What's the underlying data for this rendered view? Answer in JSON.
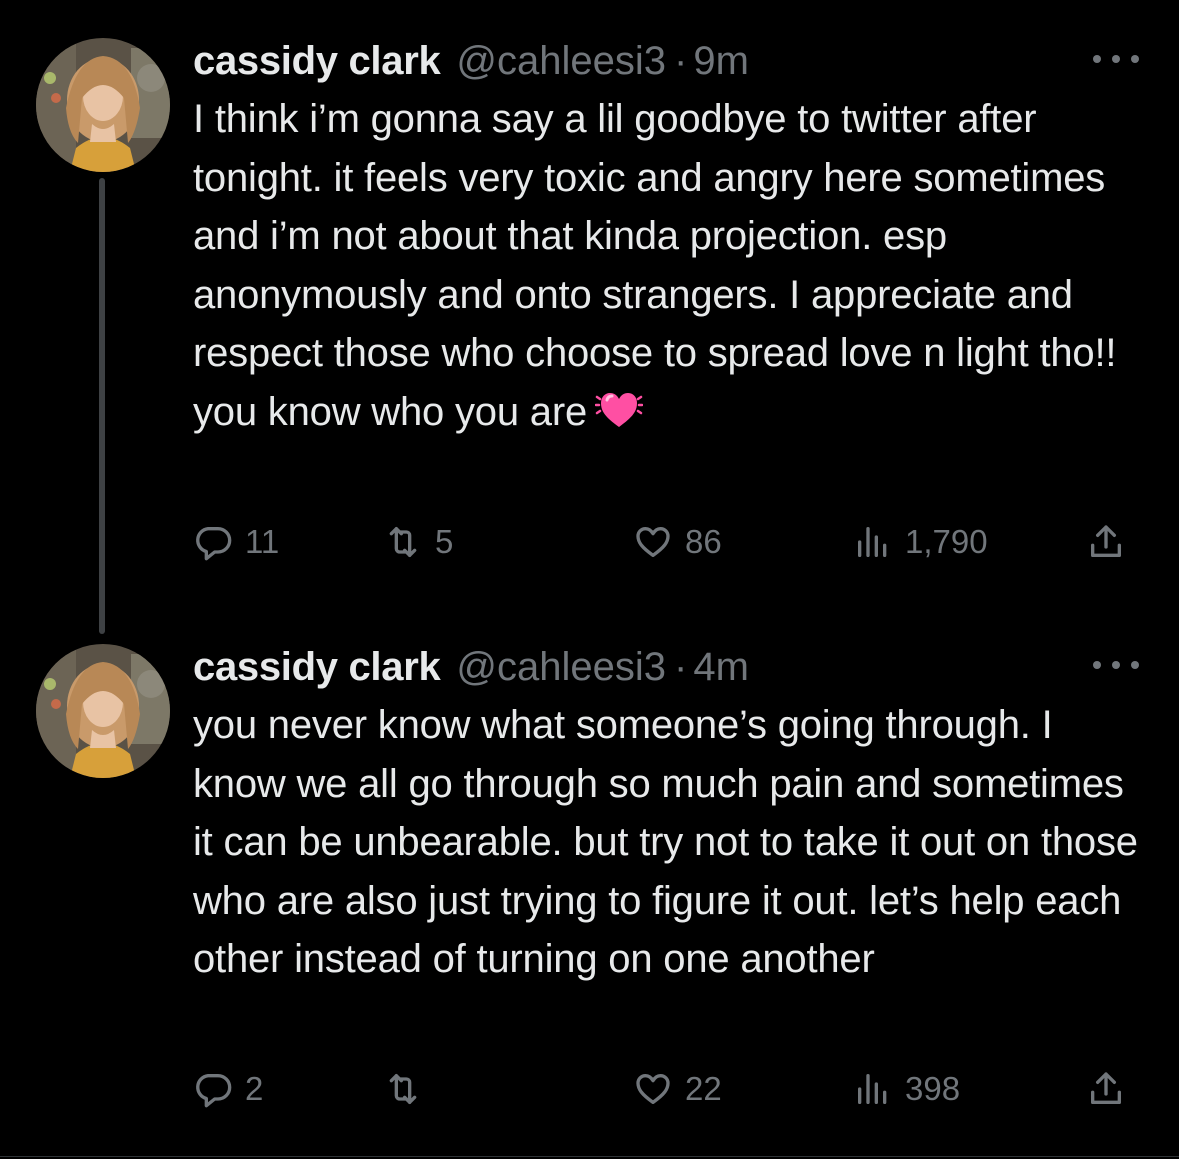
{
  "tweets": [
    {
      "name": "cassidy clark",
      "handle": "@cahleesi3",
      "separator": "·",
      "time": "9m",
      "text": "I think i’m gonna say a lil goodbye to twitter after tonight. it feels very toxic and angry here sometimes and i’m not about that kinda projection. esp anonymously and onto strangers. I appreciate and respect those who choose to spread love n light tho!! you know who you are",
      "emoji": "beating-heart-emoji",
      "replies": "11",
      "retweets": "5",
      "likes": "86",
      "views": "1,790"
    },
    {
      "name": "cassidy clark",
      "handle": "@cahleesi3",
      "separator": "·",
      "time": "4m",
      "text": "you never know what someone’s going through. I know we all go through so much pain and sometimes it can be unbearable. but try not to take it out on those who are also just trying to figure it out. let’s help each other instead of turning on one another",
      "replies": "2",
      "retweets": "",
      "likes": "22",
      "views": "398"
    }
  ],
  "colors": {
    "background": "#000000",
    "text": "#e7e9ea",
    "muted": "#71767b",
    "thread_line": "#3e4144",
    "emoji_pink": "#ff4fa3"
  },
  "icons": [
    "reply-icon",
    "retweet-icon",
    "like-icon",
    "views-icon",
    "share-icon",
    "more-icon"
  ]
}
